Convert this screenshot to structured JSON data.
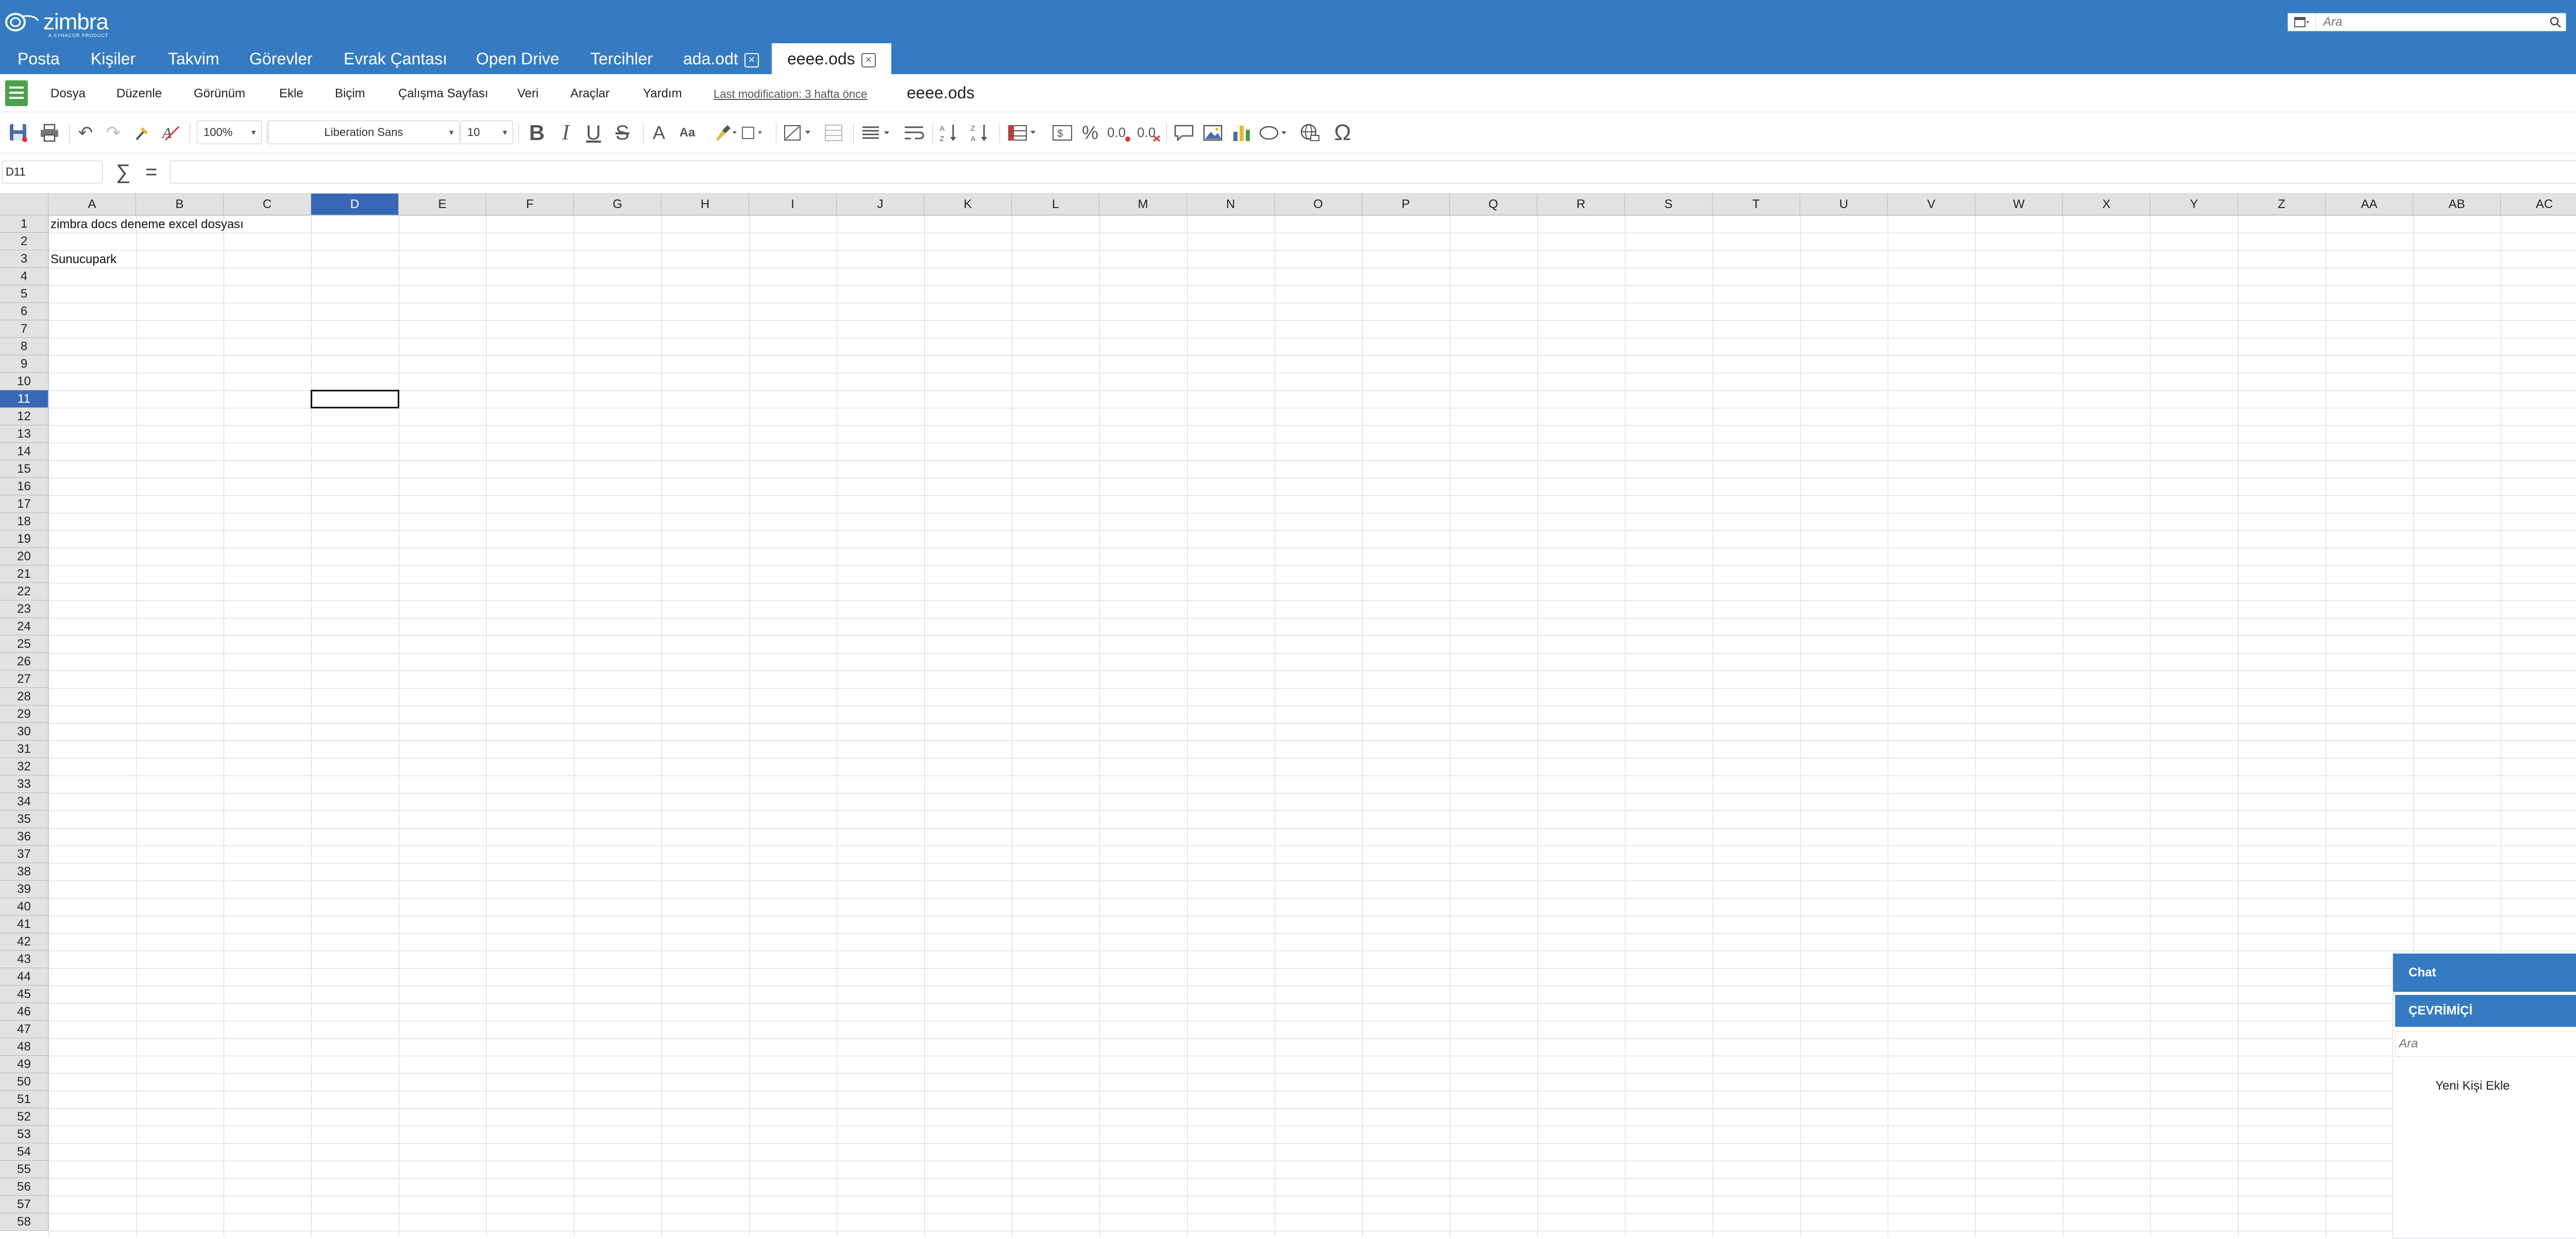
{
  "header": {
    "logo_text": "zimbra",
    "logo_tagline": "A SYNACOR PRODUCT",
    "search_placeholder": "Ara",
    "user_name": "ada"
  },
  "app_tabs": [
    {
      "label": "Posta"
    },
    {
      "label": "Kişiler"
    },
    {
      "label": "Takvim"
    },
    {
      "label": "Görevler"
    },
    {
      "label": "Evrak Çantası"
    },
    {
      "label": "Open Drive"
    },
    {
      "label": "Tercihler"
    },
    {
      "label": "ada.odt",
      "closable": true
    },
    {
      "label": "eeee.ods",
      "closable": true,
      "active": true
    }
  ],
  "menu": {
    "items": [
      "Dosya",
      "Düzenle",
      "Görünüm",
      "Ekle",
      "Biçim",
      "Çalışma Sayfası",
      "Veri",
      "Araçlar",
      "Yardım"
    ],
    "last_modification": "Last modification: 3 hafta önce",
    "document_name": "eeee.ods"
  },
  "toolbar": {
    "zoom": "100%",
    "font_name": "Liberation Sans",
    "font_size": "10",
    "bold_label": "B",
    "italic_label": "I",
    "underline_label": "U",
    "strike_label": "S",
    "font_color_label": "A",
    "font_case_label": "Aa",
    "percent_label": "%"
  },
  "formula_bar": {
    "cell_reference": "D11",
    "sum_symbol": "∑",
    "equals_symbol": "=",
    "content": ""
  },
  "sheet": {
    "columns": [
      "A",
      "B",
      "C",
      "D",
      "E",
      "F",
      "G",
      "H",
      "I",
      "J",
      "K",
      "L",
      "M",
      "N",
      "O",
      "P",
      "Q",
      "R",
      "S",
      "T",
      "U",
      "V",
      "W",
      "X",
      "Y",
      "Z",
      "AA",
      "AB",
      "AC",
      "A"
    ],
    "selected_column": "D",
    "row_count": 58,
    "selected_row": 11,
    "cells": [
      {
        "ref": "A1",
        "text": "zimbra docs deneme excel dosyası"
      },
      {
        "ref": "A3",
        "text": "Sunucupark"
      }
    ]
  },
  "chat": {
    "title": "Chat",
    "status": "ÇEVRİMİÇİ",
    "search_placeholder": "Ara",
    "add_contact": "Yeni Kişi Ekle"
  },
  "colors": {
    "brand_blue": "#367bc1",
    "selected_header": "#3868b5",
    "spreadsheet_green": "#4ca24c"
  }
}
